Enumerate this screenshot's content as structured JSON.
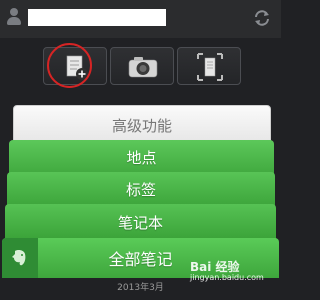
{
  "header": {
    "name_value": "",
    "icons": {
      "account": "user-icon",
      "sync": "sync-icon"
    }
  },
  "actions": {
    "icons": [
      "new-note-icon",
      "camera-icon",
      "document-scan-icon"
    ],
    "highlight_color": "#d62424"
  },
  "menu": {
    "advanced": "高级功能",
    "location": "地点",
    "tags": "标签",
    "notebook": "笔记本",
    "all_notes": "全部笔记"
  },
  "footer": {
    "date": "2013年3月",
    "watermark": "Bai 经验",
    "watermark_url": "jingyan.baidu.com"
  },
  "colors": {
    "green": "#4cb84a",
    "dark": "#202124"
  }
}
